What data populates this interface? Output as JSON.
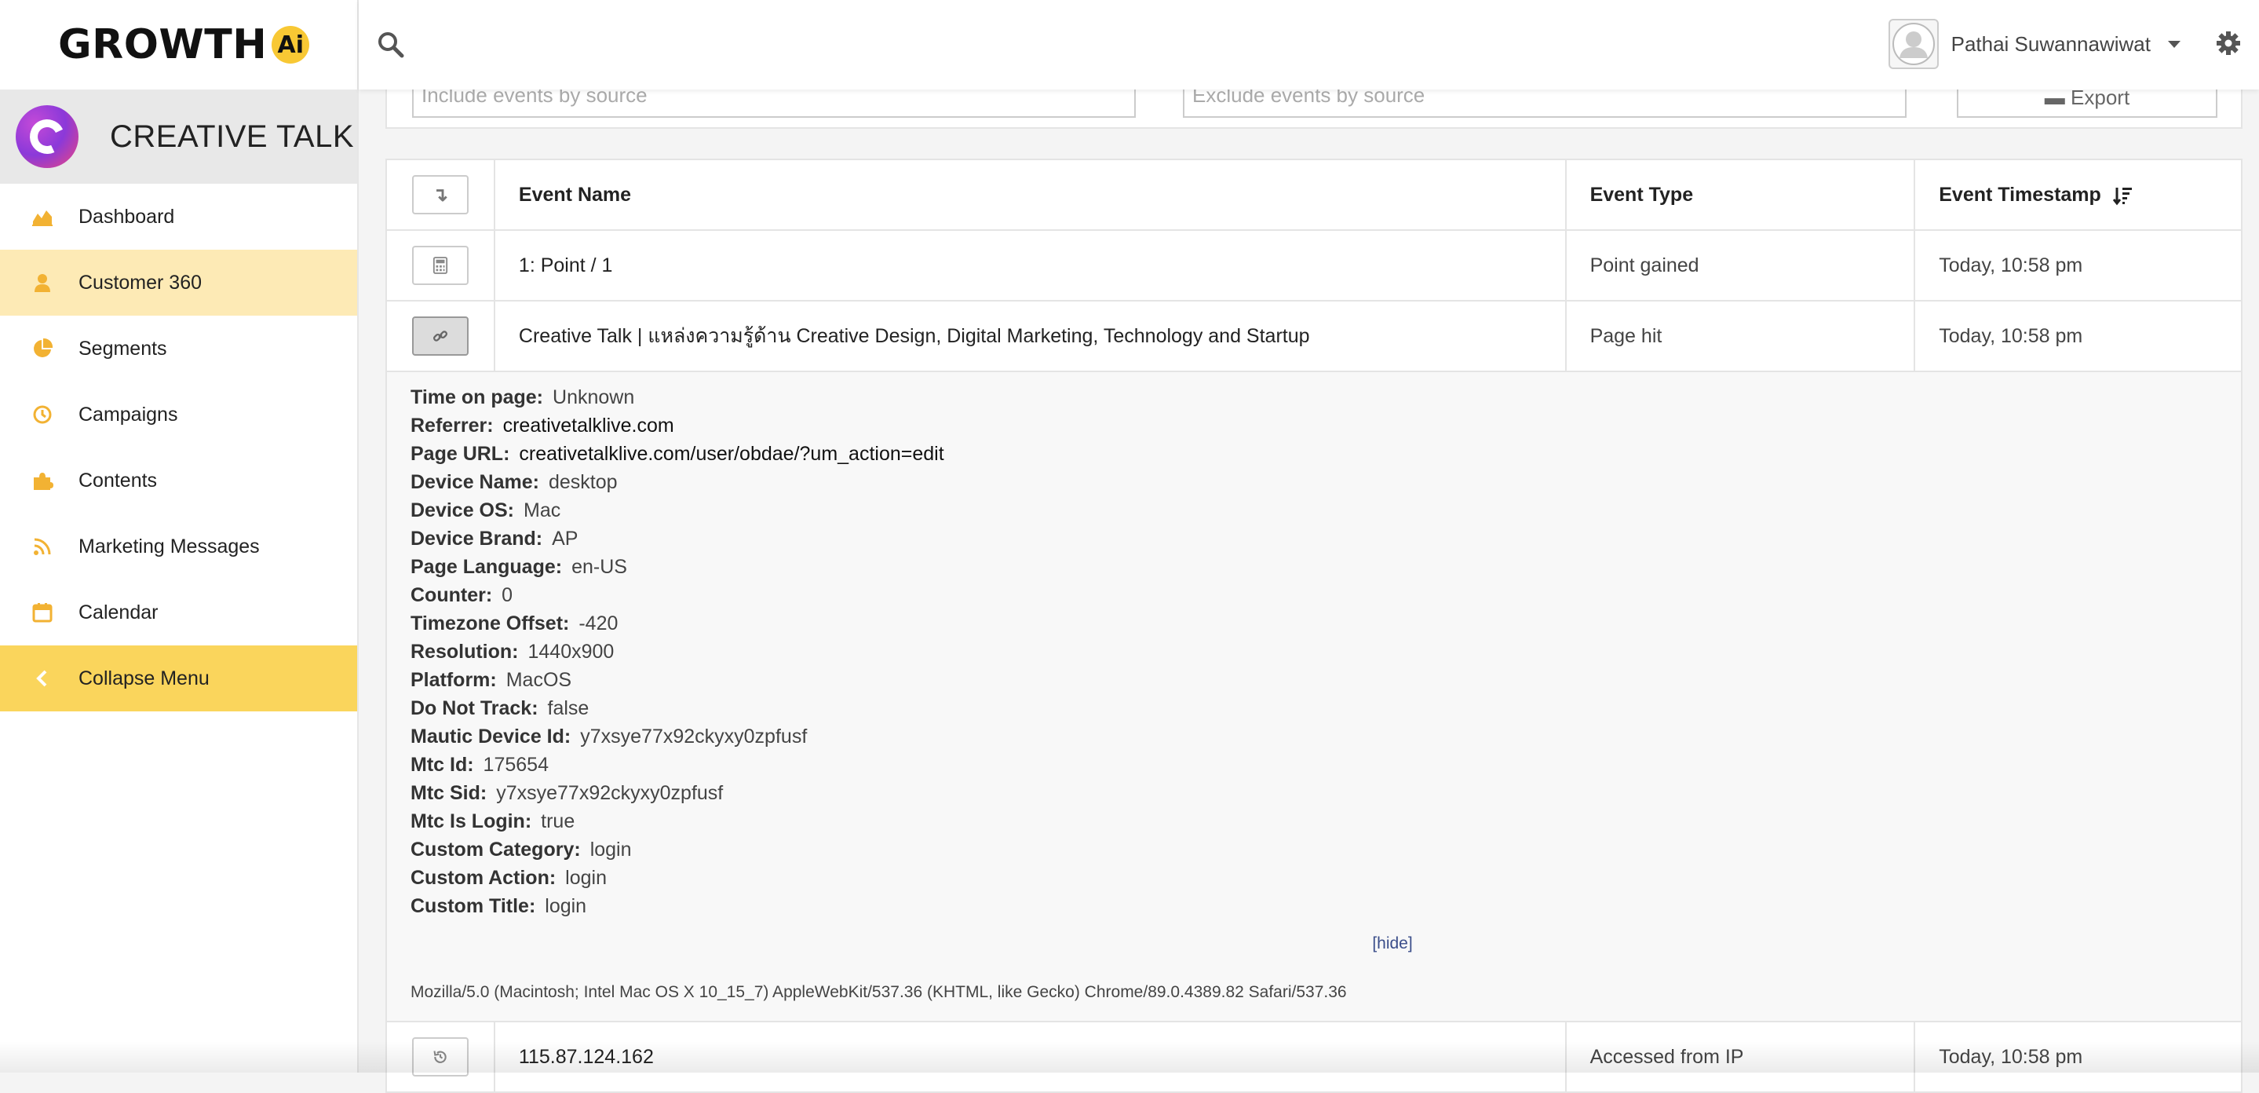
{
  "app": {
    "logo_text": "GROWTH",
    "logo_badge": "Ai",
    "brand_name": "CREATIVE TALK"
  },
  "sidebar": {
    "items": [
      {
        "label": "Dashboard",
        "icon": "chart-area-icon"
      },
      {
        "label": "Customer 360",
        "icon": "user-icon",
        "active": true
      },
      {
        "label": "Segments",
        "icon": "pie-chart-icon"
      },
      {
        "label": "Campaigns",
        "icon": "clock-icon"
      },
      {
        "label": "Contents",
        "icon": "puzzle-icon"
      },
      {
        "label": "Marketing Messages",
        "icon": "rss-icon"
      },
      {
        "label": "Calendar",
        "icon": "calendar-icon"
      },
      {
        "label": "Collapse Menu",
        "icon": "chevron-left-icon"
      }
    ],
    "accent_color": "#f2b233",
    "active_bg": "#fdeab5",
    "collapse_bg": "#fad55c"
  },
  "topbar": {
    "user_name": "Pathai Suwannawiwat"
  },
  "filters": {
    "include_placeholder": "Include events by source",
    "exclude_placeholder": "Exclude events by source",
    "export_label": "Export"
  },
  "table": {
    "headers": {
      "event_name": "Event Name",
      "event_type": "Event Type",
      "event_timestamp": "Event Timestamp"
    },
    "rows": [
      {
        "icon": "calculator-icon",
        "name": "1: Point / 1",
        "type": "Point gained",
        "timestamp": "Today, 10:58 pm"
      },
      {
        "icon": "link-icon",
        "name": "Creative Talk | แหล่งความรู้ด้าน Creative Design, Digital Marketing, Technology and Startup",
        "type": "Page hit",
        "timestamp": "Today, 10:58 pm"
      },
      {
        "icon": "history-icon",
        "name": "115.87.124.162",
        "type": "Accessed from IP",
        "timestamp": "Today, 10:58 pm"
      }
    ],
    "details": [
      {
        "key": "Time on page:",
        "value": "Unknown"
      },
      {
        "key": "Referrer:",
        "value": "creativetalklive.com"
      },
      {
        "key": "Page URL:",
        "value": "creativetalklive.com/user/obdae/?um_action=edit"
      },
      {
        "key": "Device Name:",
        "value": "desktop"
      },
      {
        "key": "Device OS:",
        "value": "Mac"
      },
      {
        "key": "Device Brand:",
        "value": "AP"
      },
      {
        "key": "Page Language:",
        "value": "en-US"
      },
      {
        "key": "Counter:",
        "value": "0"
      },
      {
        "key": "Timezone Offset:",
        "value": "-420"
      },
      {
        "key": "Resolution:",
        "value": "1440x900"
      },
      {
        "key": "Platform:",
        "value": "MacOS"
      },
      {
        "key": "Do Not Track:",
        "value": "false"
      },
      {
        "key": "Mautic Device Id:",
        "value": "y7xsye77x92ckyxy0zpfusf"
      },
      {
        "key": "Mtc Id:",
        "value": "175654"
      },
      {
        "key": "Mtc Sid:",
        "value": "y7xsye77x92ckyxy0zpfusf"
      },
      {
        "key": "Mtc Is Login:",
        "value": "true"
      },
      {
        "key": "Custom Category:",
        "value": "login"
      },
      {
        "key": "Custom Action:",
        "value": "login"
      },
      {
        "key": "Custom Title:",
        "value": "login"
      }
    ],
    "hide_label": "[hide]",
    "user_agent": "Mozilla/5.0 (Macintosh; Intel Mac OS X 10_15_7) AppleWebKit/537.36 (KHTML, like Gecko) Chrome/89.0.4389.82 Safari/537.36"
  }
}
